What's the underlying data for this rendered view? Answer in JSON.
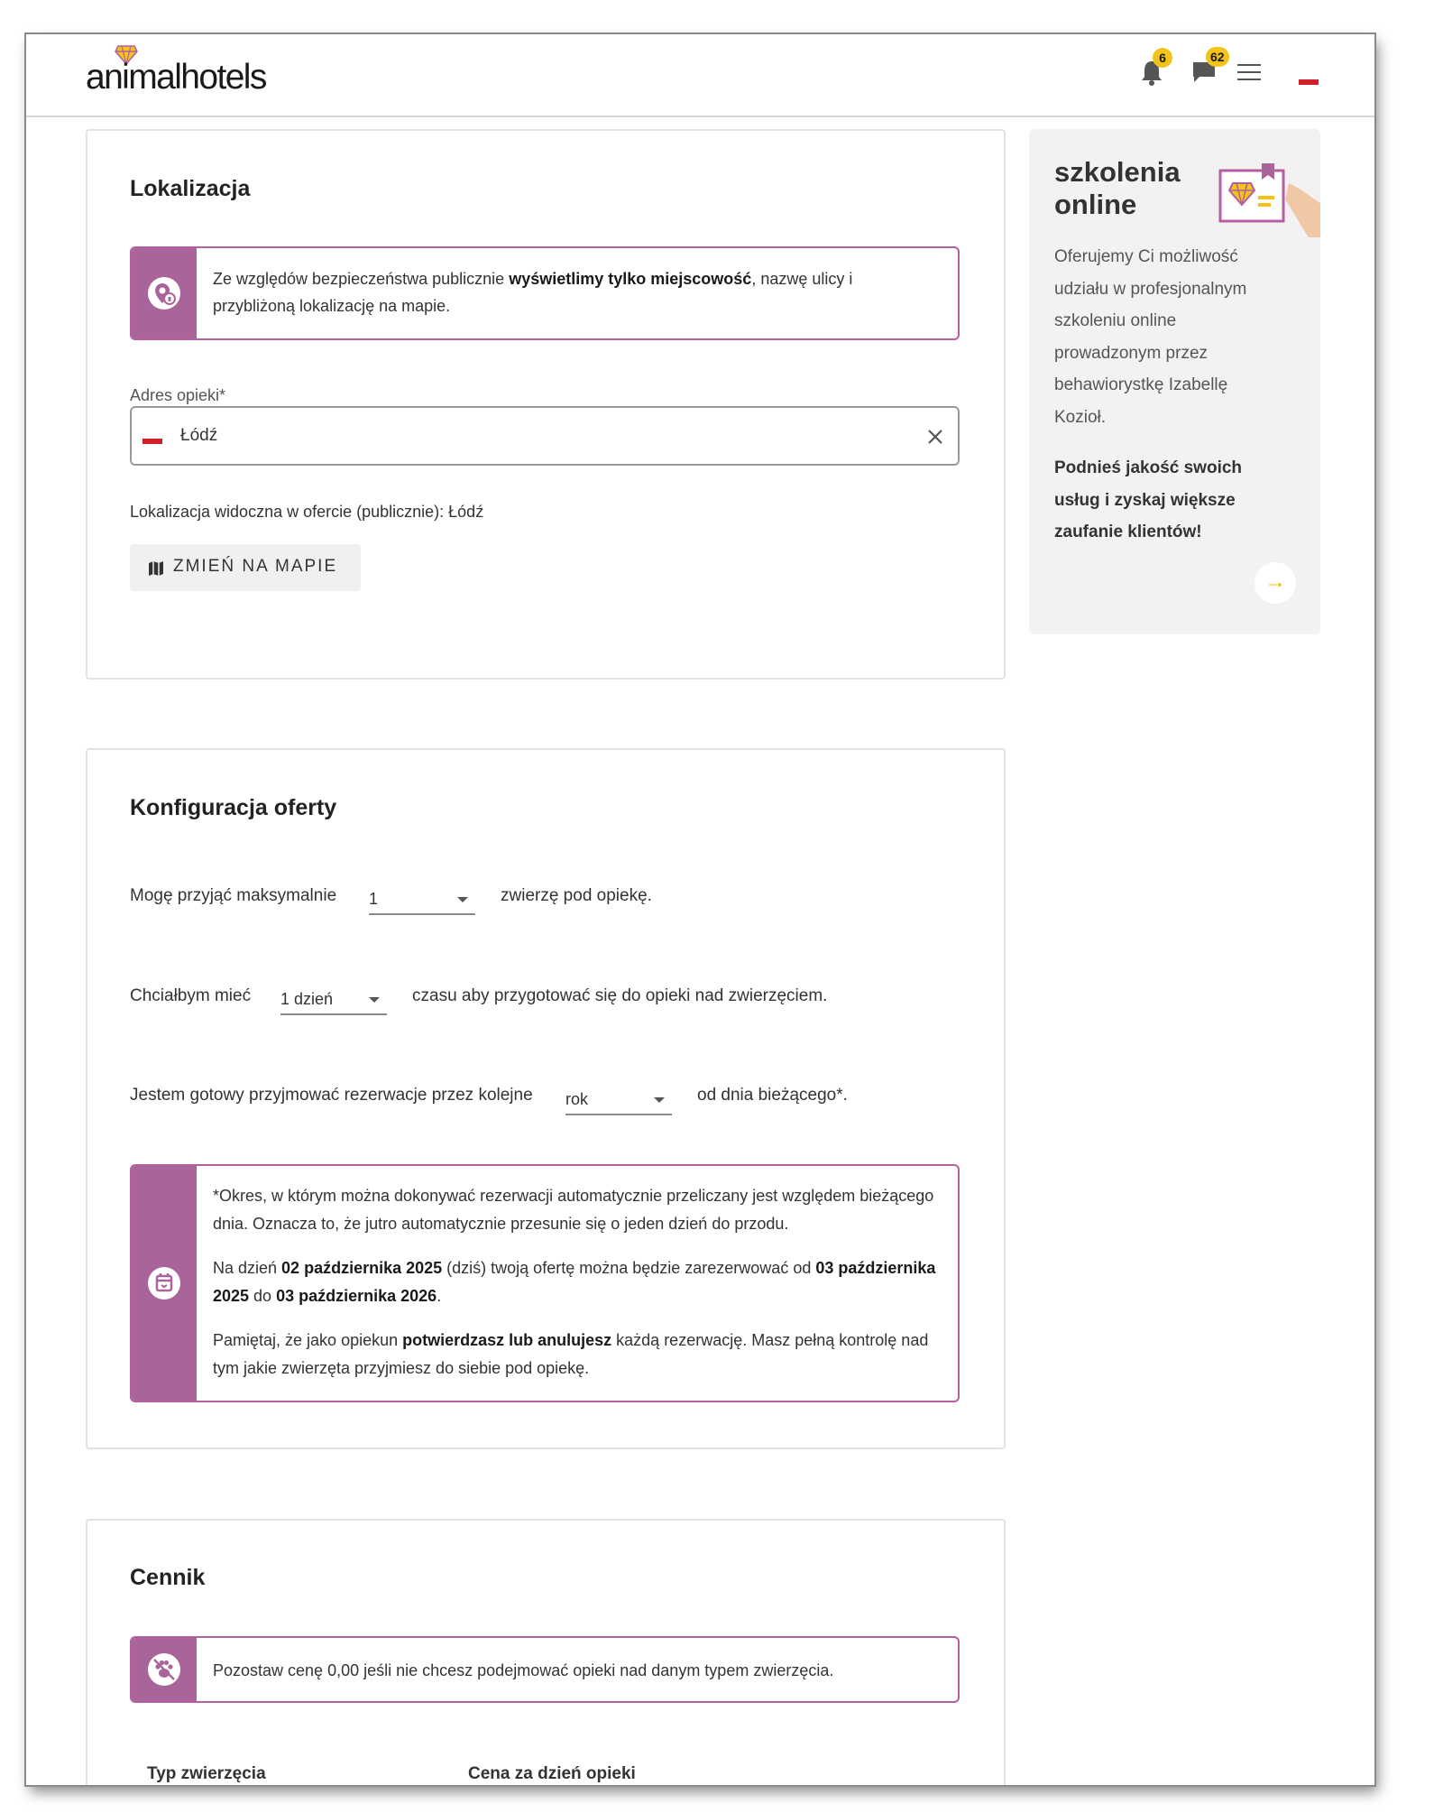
{
  "header": {
    "logo_text": "animalhotels",
    "notifications_count": "6",
    "messages_count": "62",
    "language_flag": "pl-flag"
  },
  "location": {
    "title": "Lokalizacja",
    "info_pre": "Ze względów bezpieczeństwa publicznie ",
    "info_bold": "wyświetlimy tylko miejscowość",
    "info_post": ", nazwę ulicy i przybliżoną lokalizację na mapie.",
    "address_label": "Adres opieki*",
    "address_value": "Łódź",
    "visible_text": "Lokalizacja widoczna w ofercie (publicznie): Łódź",
    "map_button": "ZMIEŃ NA MAPIE"
  },
  "config": {
    "title": "Konfiguracja oferty",
    "row1_pre": "Mogę przyjąć maksymalnie",
    "row1_value": "1",
    "row1_post": "zwierzę pod opiekę.",
    "row2_pre": "Chciałbym mieć",
    "row2_value": "1 dzień",
    "row2_post": "czasu aby przygotować się do opieki nad zwierzęciem.",
    "row3_pre": "Jestem gotowy przyjmować rezerwacje przez kolejne",
    "row3_value": "rok",
    "row3_post": "od dnia bieżącego*.",
    "note_p1": "*Okres, w którym można dokonywać rezerwacji automatycznie przeliczany jest względem bieżącego dnia. Oznacza to, że jutro automatycznie przesunie się o jeden dzień do przodu.",
    "note_p2_a": "Na dzień ",
    "note_p2_b": "02 października 2025",
    "note_p2_c": " (dziś) twoją ofertę można będzie zarezerwować od ",
    "note_p2_d": "03 października 2025",
    "note_p2_e": " do ",
    "note_p2_f": "03 października 2026",
    "note_p2_g": ".",
    "note_p3_a": "Pamiętaj, że jako opiekun ",
    "note_p3_b": "potwierdzasz lub anulujesz",
    "note_p3_c": " każdą rezerwację. Masz pełną kontrolę nad tym jakie zwierzęta przyjmiesz do siebie pod opiekę."
  },
  "pricing": {
    "title": "Cennik",
    "info": "Pozostaw cenę 0,00 jeśli nie chcesz podejmować opieki nad danym typem zwierzęcia.",
    "col_type": "Typ zwierzęcia",
    "col_price": "Cena za dzień opieki"
  },
  "promo": {
    "title_line1": "szkolenia",
    "title_line2": "online",
    "description": "Oferujemy Ci możliwość udziału w profesjonalnym szkoleniu online prowadzonym przez behawiorystkę Izabellę Kozioł.",
    "cta": "Podnieś jakość swoich usług i zyskaj większe zaufanie klientów!"
  },
  "colors": {
    "accent": "#a9649a",
    "accent_border": "#b55fa3",
    "badge": "#f2c318",
    "flag_red": "#d0202a"
  }
}
